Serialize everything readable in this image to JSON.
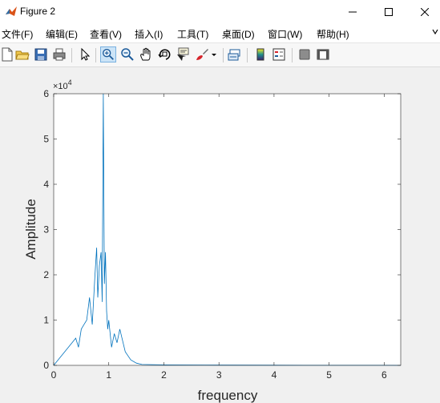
{
  "window": {
    "title": "Figure 2"
  },
  "menu": [
    {
      "label": "文件(F)"
    },
    {
      "label": "编辑(E)"
    },
    {
      "label": "查看(V)"
    },
    {
      "label": "插入(I)"
    },
    {
      "label": "工具(T)"
    },
    {
      "label": "桌面(D)"
    },
    {
      "label": "窗口(W)"
    },
    {
      "label": "帮助(H)"
    }
  ],
  "toolbar": {
    "icons": [
      "new-figure-icon",
      "open-file-icon",
      "save-icon",
      "print-icon",
      "edit-plot-arrow-icon",
      "zoom-in-icon",
      "zoom-out-icon",
      "pan-hand-icon",
      "rotate-3d-icon",
      "data-cursor-icon",
      "brush-icon",
      "link-plot-icon",
      "colorbar-icon",
      "legend-icon",
      "hide-plot-tools-icon",
      "show-plot-tools-icon"
    ]
  },
  "colors": {
    "line": "#0072bd",
    "axes_bg": "#ffffff",
    "figure_bg": "#f0f0f0"
  },
  "chart_data": {
    "type": "line",
    "title": "",
    "xlabel": "frequency",
    "ylabel": "Amplitude",
    "xlim": [
      0,
      6.3
    ],
    "ylim": [
      0,
      60000
    ],
    "xticks": [
      0,
      1,
      2,
      3,
      4,
      5,
      6
    ],
    "yticks": [
      0,
      1,
      2,
      3,
      4,
      5,
      6
    ],
    "y_exponent_label": "×10",
    "y_exponent_power": "4",
    "grid": false,
    "series": [
      {
        "x": [
          0,
          0.1,
          0.2,
          0.3,
          0.4,
          0.45,
          0.5,
          0.55,
          0.6,
          0.65,
          0.7,
          0.75,
          0.78,
          0.8,
          0.83,
          0.86,
          0.88,
          0.9,
          0.92,
          0.94,
          0.96,
          0.98,
          1.0,
          1.05,
          1.1,
          1.15,
          1.2,
          1.3,
          1.4,
          1.5,
          1.6,
          2.0,
          3.0,
          4.0,
          5.0,
          6.0,
          6.3
        ],
        "y": [
          0,
          1500,
          3000,
          4500,
          6000,
          4000,
          8000,
          9000,
          10000,
          15000,
          9000,
          20000,
          26000,
          15000,
          22000,
          25000,
          14000,
          60000,
          18000,
          25000,
          12000,
          8000,
          10000,
          4000,
          7000,
          5000,
          8000,
          3000,
          1200,
          500,
          200,
          100,
          50,
          30,
          20,
          10,
          0
        ]
      }
    ]
  }
}
